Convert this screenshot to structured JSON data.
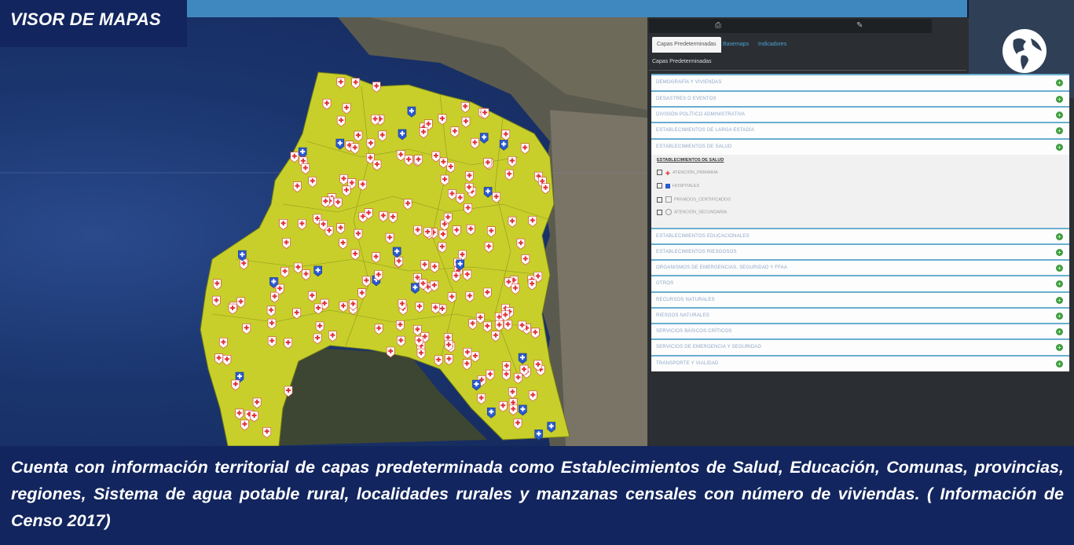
{
  "header": {
    "title": "VISOR DE MAPAS"
  },
  "panel": {
    "tabs": [
      {
        "label": "Capas Predeterminadas",
        "active": true
      },
      {
        "label": "Basemaps",
        "active": false
      },
      {
        "label": "Indicadores",
        "active": false
      }
    ],
    "section_title": "Capas Predeterminadas",
    "layers_top": [
      "DEMOGRAFÍA Y VIVIENDAS",
      "DESASTRES O EVENTOS",
      "DIVISIÓN POLÍTICO ADMINISTRATIVA",
      "ESTABLECIMIENTOS DE LARGA ESTADÍA",
      "ESTABLECIMIENTOS DE SALUD"
    ],
    "salud": {
      "title": "ESTABLECIMIENTOS DE SALUD",
      "items": [
        "ATENCIÓN_PRIMARIA",
        "HOSPITALES",
        "PRIVADOS_CERTIFICADOS",
        "ATENCIÓN_SECUNDARIA"
      ]
    },
    "layers_bottom": [
      "ESTABLECIMIENTOS EDUCACIONALES",
      "ESTABLECIMIENTOS RIESGOSOS",
      "ORGANISMOS DE EMERGENCIAS, SEGURIDAD Y FFAA",
      "OTROS",
      "RECURSOS NATURALES",
      "RIESGOS NATURALES",
      "SERVICIOS BÁSICOS CRÍTICOS",
      "SERVICIOS DE EMERGENCIA Y SEGURIDAD",
      "TRANSPORTE Y VIALIDAD"
    ]
  },
  "icons": {
    "globe": "globe-icon",
    "print": "print-icon",
    "tool": "wrench-icon",
    "expand": "plus-circle-icon",
    "health_marker": "red-cross-marker-icon",
    "hospital_marker": "hospital-marker-icon"
  },
  "colors": {
    "header_bg": "#12255e",
    "region_fill": "#c8cf2a",
    "primary_care": "#e0303a",
    "hospital": "#2a5ad0",
    "expand_btn": "#3e9d3e"
  },
  "caption": "Cuenta con información territorial de capas predeterminada como Establecimientos de Salud, Educación, Comunas, provincias, regiones, Sistema de agua potable rural, localidades rurales y manzanas censales con número de viviendas. ( Información de Censo 2017)"
}
